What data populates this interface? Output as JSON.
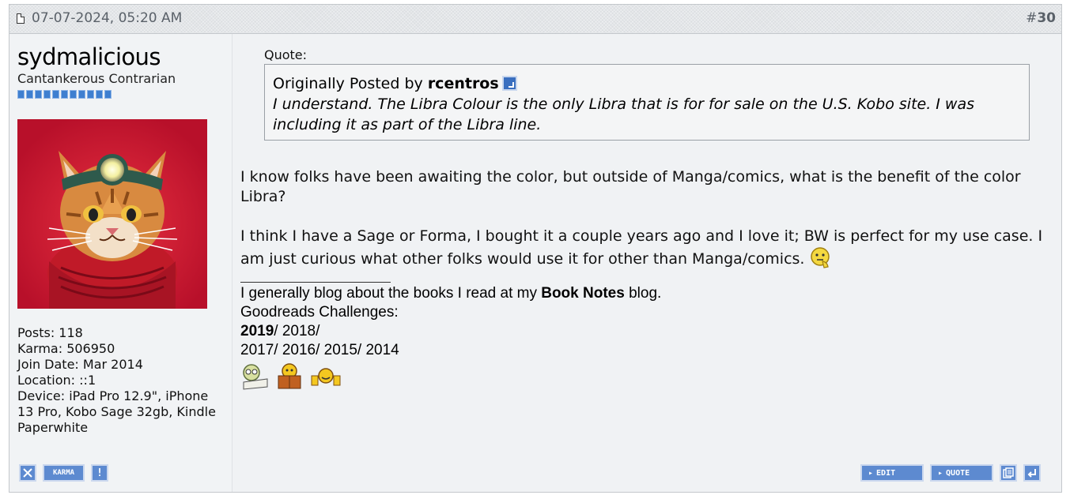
{
  "post": {
    "date": "07-07-2024, 05:20 AM",
    "number_hash": "#",
    "number": "30"
  },
  "user": {
    "name": "sydmalicious",
    "title": "Cantankerous Contrarian",
    "stats": [
      {
        "label": "Posts:",
        "value": "118"
      },
      {
        "label": "Karma:",
        "value": "506950"
      },
      {
        "label": "Join Date:",
        "value": "Mar 2014"
      },
      {
        "label": "Location:",
        "value": "::1"
      },
      {
        "label": "Device:",
        "value": "iPad Pro 12.9\", iPhone 13 Pro, Kobo Sage 32gb, Kindle Paperwhite"
      }
    ],
    "karma_button": "KARMA",
    "report_button": "!"
  },
  "quote": {
    "label": "Quote:",
    "originally_posted_by": "Originally Posted by",
    "author": "rcentros",
    "text": "I understand. The Libra Colour is the only Libra that is for for sale on the U.S. Kobo site. I was including it as part of the Libra line."
  },
  "body": {
    "p1": "I know folks have been awaiting the color, but outside of Manga/comics, what is the benefit of the color Libra?",
    "p2": "I think I have a Sage or Forma, I bought it a couple years ago and I love it; BW is perfect for my use case. I am just curious what other folks would use it for other than Manga/comics."
  },
  "signature": {
    "line1_pre": "I generally blog about the books I read at my ",
    "line1_link": "Book Notes",
    "line1_post": " blog.",
    "line2": "Goodreads Challenges:",
    "y2019": "2019",
    "y2018": "/ 2018/",
    "line4": "2017/ 2016/ 2015/ 2014"
  },
  "buttons": {
    "edit": "EDIT",
    "quote": "QUOTE"
  },
  "colors": {
    "button_blue": "#5d8ad0",
    "avatar_bg": "#d01830",
    "header_bg": "#dcdfe2"
  }
}
